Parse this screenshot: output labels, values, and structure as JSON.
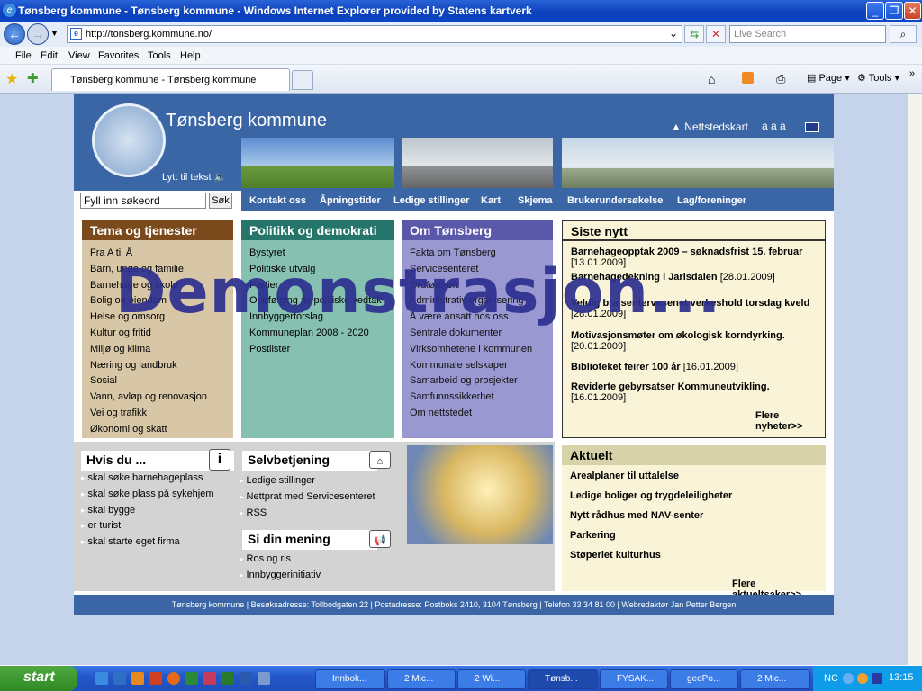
{
  "window": {
    "title": "Tønsberg kommune - Tønsberg kommune - Windows Internet Explorer provided by Statens kartverk"
  },
  "browser": {
    "url": "http://tonsberg.kommune.no/",
    "search_placeholder": "Live Search",
    "menu": [
      "File",
      "Edit",
      "View",
      "Favorites",
      "Tools",
      "Help"
    ],
    "tab_title": "Tønsberg kommune - Tønsberg kommune",
    "toolbar": {
      "page": "Page",
      "tools": "Tools"
    }
  },
  "site": {
    "title": "Tønsberg kommune",
    "listen": "Lytt til tekst",
    "sitemap": "Nettstedskart",
    "text_size": "a a a",
    "search_placeholder": "Fyll inn søkeord",
    "search_button": "Søk",
    "topnav": [
      "Kontakt oss",
      "Åpningstider",
      "Ledige stillinger",
      "Kart",
      "Skjema",
      "Brukerundersøkelse",
      "Lag/foreninger"
    ],
    "col1": {
      "title": "Tema og tjenester",
      "items": [
        "Fra A til Å",
        "Barn, unge og familie",
        "Barnehage og skole",
        "Bolig og eiendom",
        "Helse og omsorg",
        "Kultur og fritid",
        "Miljø og klima",
        "Næring og landbruk",
        "Sosial",
        "Vann, avløp og renovasjon",
        "Vei og trafikk",
        "Økonomi og skatt"
      ]
    },
    "col2": {
      "title": "Politikk og demokrati",
      "items": [
        "Bystyret",
        "Politiske utvalg",
        "Partier",
        "Oppfølging av politiske vedtak",
        "Innbyggerforslag",
        "Kommuneplan 2008 - 2020",
        "Postlister"
      ]
    },
    "col3": {
      "title": "Om Tønsberg",
      "items": [
        "Fakta om Tønsberg",
        "Servicesenteret",
        "Ordføreren",
        "Administrativ organisering",
        "Å være ansatt hos oss",
        "Sentrale dokumenter",
        "Virksomhetene i kommunen",
        "Kommunale selskaper",
        "Samarbeid og prosjekter",
        "Samfunnssikkerhet",
        "Om nettstedet"
      ]
    },
    "news": {
      "title": "Siste nytt",
      "items": [
        {
          "headline": "Barnehageopptak 2009 – søknadsfrist 15. februar",
          "date": "[13.01.2009]"
        },
        {
          "headline": "Barnehagedekning i Jarlsdalen",
          "date": "[28.01.2009]"
        },
        {
          "headline": "Veldig bra sentervesenet verkeshold torsdag kveld",
          "date": "[28.01.2009]"
        },
        {
          "headline": "Motivasjonsmøter om økologisk korndyrking.",
          "date": "[20.01.2009]"
        },
        {
          "headline": "Biblioteket feirer 100 år",
          "date": "[16.01.2009]"
        },
        {
          "headline": "Reviderte gebyrsatser Kommuneutvikling.",
          "date": "[16.01.2009]"
        }
      ],
      "more": "Flere nyheter>>"
    },
    "hvis": {
      "title": "Hvis du ...",
      "items": [
        "skal søke barnehageplass",
        "skal søke plass på sykehjem",
        "skal bygge",
        "er turist",
        "skal starte eget firma"
      ]
    },
    "selv": {
      "title": "Selvbetjening",
      "items": [
        "Ledige stillinger",
        "Nettprat med Servicesenteret",
        "RSS"
      ]
    },
    "mening": {
      "title": "Si din mening",
      "items": [
        "Ros og ris",
        "Innbyggerinitiativ"
      ]
    },
    "aktuelt": {
      "title": "Aktuelt",
      "items": [
        "Arealplaner til uttalelse",
        "Ledige boliger og trygdeleiligheter",
        "Nytt rådhus med NAV-senter",
        "Parkering",
        "Støperiet kulturhus"
      ],
      "more": "Flere aktueltsaker>>"
    },
    "footer": "Tønsberg kommune | Besøksadresse: Tollbodgaten 22 | Postadresse: Postboks 2410, 3104 Tønsberg | Telefon 33 34 81 00 | Webredaktør Jan Petter Bergen"
  },
  "overlay": {
    "watermark": "Demonstrasjon..."
  },
  "taskbar": {
    "start": "start",
    "tasks": [
      "Innbok...",
      "2 Mic...",
      "2 Wi...",
      "Tønsb...",
      "FYSAK...",
      "geoPo...",
      "2 Mic..."
    ],
    "tray_lang": "NC",
    "clock": "13:15"
  }
}
